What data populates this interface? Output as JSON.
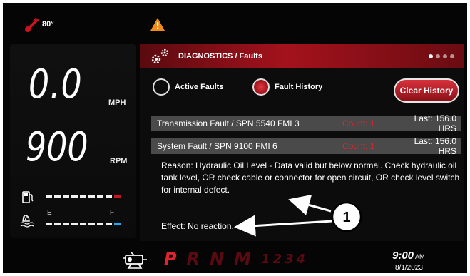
{
  "status": {
    "temperature": "80°"
  },
  "gauges": {
    "speed_value": "0.0",
    "speed_unit": "MPH",
    "rpm_value": "900",
    "rpm_unit": "RPM",
    "fuel_level_fraction": 0.9,
    "def_level_fraction": 1.0,
    "def_empty_label": "E",
    "def_full_label": "F"
  },
  "diagnostics": {
    "title": "DIAGNOSTICS / Faults",
    "page_dots": {
      "total": 4,
      "current": 1
    },
    "tabs": [
      {
        "label": "Active Faults",
        "selected": false
      },
      {
        "label": "Fault History",
        "selected": true
      }
    ],
    "clear_button_label": "Clear History",
    "faults": [
      {
        "title": "Transmission Fault / SPN 5540 FMI 3",
        "count": "Count: 1",
        "last": "Last: 156.0 HRS"
      },
      {
        "title": "System Fault / SPN 9100 FMI 6",
        "count": "Count: 1",
        "last": "Last: 156.0 HRS"
      }
    ],
    "reason": "Reason: Hydraulic Oil Level - Data valid but below normal.  Check hydraulic oil tank level, OR check cable or connector for open circuit, OR check level switch for internal defect.",
    "effect": "Effect: No reaction."
  },
  "transmission": {
    "gears": [
      {
        "label": "P",
        "active": true
      },
      {
        "label": "R",
        "active": false
      },
      {
        "label": "N",
        "active": false
      },
      {
        "label": "M",
        "active": false
      }
    ],
    "manual_gears": [
      "1",
      "2",
      "3",
      "4"
    ]
  },
  "clock": {
    "time": "9:00",
    "ampm": "AM",
    "date": "8/1/2023"
  },
  "callout": {
    "number": "1"
  },
  "colors": {
    "accent_red": "#c8141e",
    "def_blue": "#28a8e8",
    "fuel_red": "#c8141e"
  }
}
